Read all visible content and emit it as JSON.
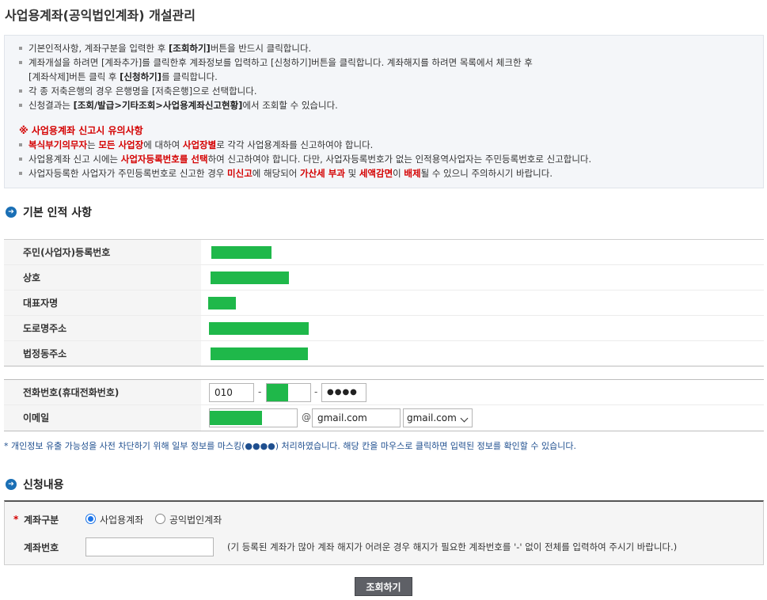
{
  "page": {
    "title": "사업용계좌(공익법인계좌) 개설관리"
  },
  "notice": {
    "line1": [
      "기본인적사항, 계좌구분을 입력한 후 ",
      "[조회하기]",
      "버튼을 반드시 클릭합니다."
    ],
    "line2": "계좌개설을 하려면 [계좌추가]를 클릭한후 계좌정보를 입력하고 [신청하기]버튼을 클릭합니다. 계좌해지를 하려면 목록에서 체크한 후",
    "line3": [
      "[계좌삭제]버튼 클릭 후 ",
      "[신청하기]",
      "를 클릭합니다."
    ],
    "line4": "각 종 저축은행의 경우 은행명을 [저축은행]으로 선택합니다.",
    "line5": [
      "신청결과는 ",
      "[조회/발급>기타조회>사업용계좌신고현황]",
      "에서 조회할 수 있습니다."
    ],
    "warn_title": "※ 사업용계좌 신고시 유의사항",
    "warn1": [
      "복식부기의무자",
      "는 ",
      "모든 사업장",
      "에 대하여 ",
      "사업장별",
      "로 각각 사업용계좌를 신고하여야 합니다."
    ],
    "warn2": [
      "사업용계좌 신고 시에는 ",
      "사업자등록번호를 선택",
      "하여 신고하여야 합니다. 다만, 사업자등록번호가 없는 인적용역사업자는 주민등록번호로 신고합니다."
    ],
    "warn3": [
      "사업자등록한 사업자가 주민등록번호로 신고한 경우 ",
      "미신고",
      "에 해당되어 ",
      "가산세 부과",
      " 및 ",
      "세액감면",
      "이 ",
      "배제",
      "될 수 있으니 주의하시기 바랍니다."
    ]
  },
  "basic_info": {
    "section_title": "기본 인적 사항",
    "rows": [
      {
        "label": "주민(사업자)등록번호"
      },
      {
        "label": "상호"
      },
      {
        "label": "대표자명"
      },
      {
        "label": "도로명주소"
      },
      {
        "label": "법정동주소"
      }
    ],
    "phone_label": "전화번호(휴대전화번호)",
    "phone1": "010",
    "phone_sep": "-",
    "phone3": "●●●●",
    "email_label": "이메일",
    "email_at": "@",
    "email_domain": "gmail.com",
    "email_domain_select": "gmail.com"
  },
  "privacy_note": "* 개인정보 유출 가능성을 사전 차단하기 위해 일부 정보를 마스킹(●●●●) 처리하였습니다. 해당 칸을 마우스로 클릭하면 입력된 정보를 확인할 수 있습니다.",
  "application": {
    "section_title": "신청내용",
    "required_mark": "*",
    "account_type_label": "계좌구분",
    "option_business": "사업용계좌",
    "option_public": "공익법인계좌",
    "selected": "사업용계좌",
    "account_no_label": "계좌번호",
    "account_no_help": "(기 등록된 계좌가 많아 계좌 해지가 어려운 경우 해지가 필요한 계좌번호를 '-' 없이 전체를 입력하여 주시기 바랍니다.)"
  },
  "buttons": {
    "query": "조회하기"
  },
  "colors": {
    "mask": "#1fb84a",
    "accent": "#1a6fb5",
    "warn": "#d40000",
    "button": "#5e6066"
  }
}
